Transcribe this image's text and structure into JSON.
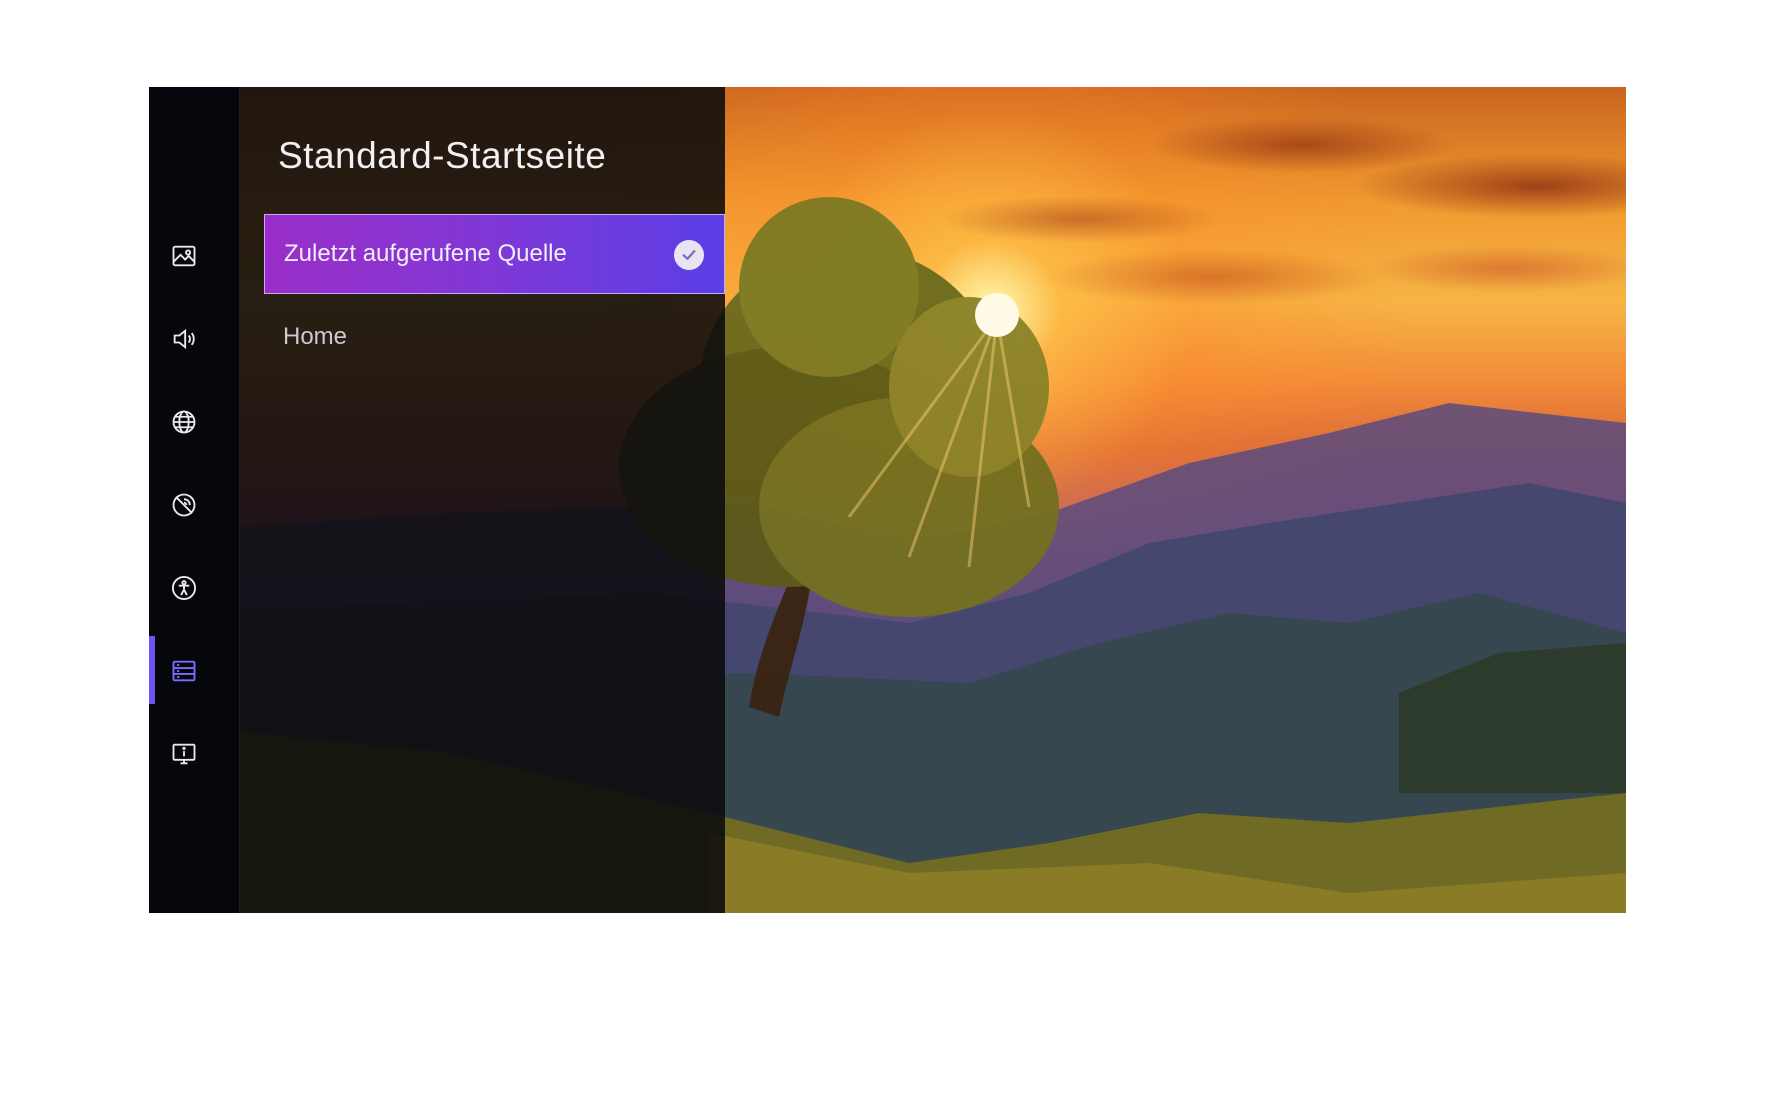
{
  "panel": {
    "title": "Standard-Startseite",
    "options": [
      {
        "label": "Zuletzt aufgerufene Quelle",
        "selected": true
      },
      {
        "label": "Home",
        "selected": false
      }
    ]
  },
  "rail": {
    "icons": [
      {
        "name": "picture-icon"
      },
      {
        "name": "sound-icon"
      },
      {
        "name": "globe-icon"
      },
      {
        "name": "disabled-signal-icon"
      },
      {
        "name": "accessibility-icon"
      },
      {
        "name": "system-list-icon",
        "active": true
      },
      {
        "name": "tv-info-icon"
      }
    ]
  },
  "colors": {
    "accent": "#6b55f2",
    "selected_gradient_start": "#9b2ec8",
    "selected_gradient_end": "#5a3ee6"
  }
}
